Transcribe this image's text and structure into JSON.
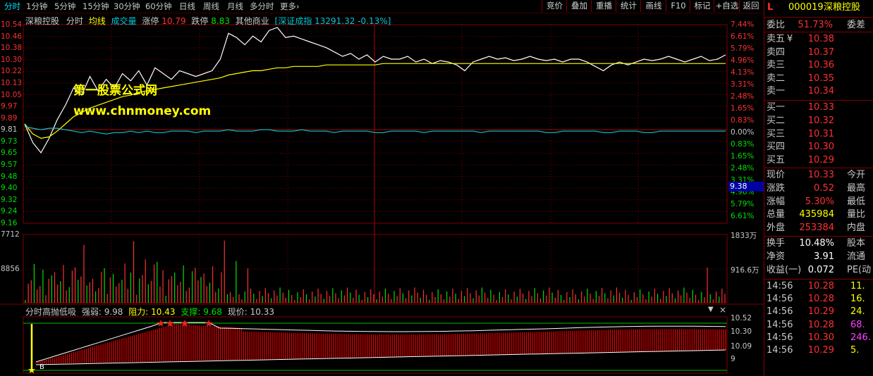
{
  "toolbar": {
    "timeframes": [
      "分时",
      "1分钟",
      "5分钟",
      "15分钟",
      "30分钟",
      "60分钟",
      "日线",
      "周线",
      "月线",
      "多分时",
      "更多›"
    ],
    "tools": [
      "竞价",
      "叠加",
      "重播",
      "统计",
      "画线",
      "F10",
      "标记",
      "+自选",
      "返回"
    ]
  },
  "chart_header": {
    "stock_name": "深粮控股",
    "mode": "分时",
    "avg_label": "均线",
    "volume_label": "成交量",
    "limit_up_label": "涨停",
    "limit_up_value": "10.79",
    "limit_down_label": "跌停",
    "limit_down_value": "8.83",
    "sector": "其他商业",
    "index_text": "[深证成指 13291.32 -0.13%]"
  },
  "price_axis": {
    "left": [
      "10.54",
      "10.46",
      "10.38",
      "10.30",
      "10.22",
      "10.13",
      "10.05",
      "9.97",
      "9.89",
      "9.81",
      "9.73",
      "9.65",
      "9.57",
      "9.48",
      "9.40",
      "9.32",
      "9.24",
      "9.16"
    ],
    "right": [
      "7.44%",
      "6.61%",
      "5.79%",
      "4.96%",
      "4.13%",
      "3.31%",
      "2.48%",
      "1.65%",
      "0.83%",
      "0.00%",
      "0.83%",
      "1.65%",
      "2.48%",
      "3.31%",
      "4.96%",
      "5.79%",
      "6.61%"
    ],
    "cursor_value": "9.38"
  },
  "volume_axis": {
    "left_top": "7712",
    "left_mid": "8856",
    "right_top": "1833万",
    "right_mid": "916.6万"
  },
  "watermark": {
    "line1": "第一股票公式网",
    "line2": "www.chnmoney.com"
  },
  "indicator": {
    "name": "分时高抛低吸",
    "strength_label": "强弱:",
    "strength_value": "9.98",
    "resistance_label": "阻力:",
    "resistance_value": "10.43",
    "support_label": "支撑:",
    "support_value": "9.68",
    "price_label": "现价:",
    "price_value": "10.33",
    "axis": [
      "10.52",
      "10.30",
      "10.09",
      "9"
    ],
    "buy_marker": "B"
  },
  "quote": {
    "code_prefix": "L",
    "code": "000019",
    "name": "深粮控股",
    "weibi_label": "委比",
    "weibi_value": "51.73%",
    "weicha_label": "委差",
    "asks": [
      {
        "label": "卖五",
        "mark": "¥",
        "price": "10.38"
      },
      {
        "label": "卖四",
        "mark": "",
        "price": "10.37"
      },
      {
        "label": "卖三",
        "mark": "",
        "price": "10.36"
      },
      {
        "label": "卖二",
        "mark": "",
        "price": "10.35"
      },
      {
        "label": "卖一",
        "mark": "",
        "price": "10.34"
      }
    ],
    "bids": [
      {
        "label": "买一",
        "price": "10.33"
      },
      {
        "label": "买二",
        "price": "10.32"
      },
      {
        "label": "买三",
        "price": "10.31"
      },
      {
        "label": "买四",
        "price": "10.30"
      },
      {
        "label": "买五",
        "price": "10.29"
      }
    ],
    "stats": [
      {
        "label": "现价",
        "value": "10.33",
        "right": "今开",
        "color": "red"
      },
      {
        "label": "涨跌",
        "value": "0.52",
        "right": "最高",
        "color": "red"
      },
      {
        "label": "涨幅",
        "value": "5.30%",
        "right": "最低",
        "color": "red"
      },
      {
        "label": "总量",
        "value": "435984",
        "right": "量比",
        "color": "yellow"
      },
      {
        "label": "外盘",
        "value": "253384",
        "right": "内盘",
        "color": "red"
      }
    ],
    "stats2": [
      {
        "label": "换手",
        "value": "10.48%",
        "right": "股本",
        "color": "white"
      },
      {
        "label": "净资",
        "value": "3.91",
        "right": "流通",
        "color": "white"
      },
      {
        "label": "收益(一)",
        "value": "0.072",
        "right": "PE(动",
        "color": "white"
      }
    ],
    "ticks": [
      {
        "time": "14:56",
        "price": "10.28",
        "vol": "11.",
        "vc": "yellow"
      },
      {
        "time": "14:56",
        "price": "10.28",
        "vol": "16.",
        "vc": "yellow"
      },
      {
        "time": "14:56",
        "price": "10.29",
        "vol": "24.",
        "vc": "yellow"
      },
      {
        "time": "14:56",
        "price": "10.28",
        "vol": "68.",
        "vc": "magenta"
      },
      {
        "time": "14:56",
        "price": "10.30",
        "vol": "246.",
        "vc": "magenta"
      },
      {
        "time": "14:56",
        "price": "10.29",
        "vol": "5.",
        "vc": "yellow"
      }
    ]
  },
  "colors": {
    "up": "#ff3030",
    "down": "#00e000",
    "price_line": "#ffffff",
    "avg_line": "#ffff00",
    "index_line": "#00c8d8",
    "grid": "#800000"
  },
  "chart_data": {
    "type": "line",
    "title": "",
    "prev_close": 9.81,
    "ylim": [
      9.16,
      10.54
    ],
    "series": [
      {
        "name": "分时",
        "values": [
          9.85,
          9.72,
          9.65,
          9.75,
          9.88,
          9.98,
          10.1,
          10.05,
          10.18,
          10.08,
          10.16,
          10.1,
          10.2,
          10.15,
          10.22,
          10.12,
          10.24,
          10.2,
          10.16,
          10.22,
          10.2,
          10.18,
          10.2,
          10.22,
          10.3,
          10.48,
          10.45,
          10.4,
          10.46,
          10.42,
          10.5,
          10.52,
          10.45,
          10.46,
          10.44,
          10.42,
          10.4,
          10.38,
          10.35,
          10.32,
          10.34,
          10.3,
          10.33,
          10.28,
          10.32,
          10.3,
          10.3,
          10.32,
          10.28,
          10.3,
          10.27,
          10.29,
          10.28,
          10.26,
          10.22,
          10.28,
          10.3,
          10.32,
          10.3,
          10.31,
          10.29,
          10.3,
          10.32,
          10.3,
          10.29,
          10.3,
          10.28,
          10.3,
          10.3,
          10.28,
          10.25,
          10.22,
          10.26,
          10.28,
          10.26,
          10.28,
          10.3,
          10.29,
          10.3,
          10.32,
          10.3,
          10.28,
          10.3,
          10.32,
          10.29,
          10.3,
          10.33
        ]
      },
      {
        "name": "均线",
        "values": [
          9.85,
          9.78,
          9.75,
          9.76,
          9.8,
          9.85,
          9.9,
          9.93,
          9.96,
          9.98,
          10.0,
          10.02,
          10.04,
          10.05,
          10.07,
          10.08,
          10.09,
          10.1,
          10.11,
          10.12,
          10.13,
          10.14,
          10.15,
          10.16,
          10.17,
          10.19,
          10.2,
          10.21,
          10.22,
          10.22,
          10.23,
          10.24,
          10.24,
          10.25,
          10.25,
          10.25,
          10.25,
          10.26,
          10.26,
          10.26,
          10.26,
          10.26,
          10.26,
          10.26,
          10.27,
          10.27,
          10.27,
          10.27,
          10.27,
          10.27,
          10.27,
          10.27,
          10.27,
          10.27,
          10.27,
          10.27,
          10.27,
          10.27,
          10.27,
          10.27,
          10.27,
          10.27,
          10.27,
          10.27,
          10.27,
          10.27,
          10.27,
          10.27,
          10.27,
          10.27,
          10.27,
          10.27,
          10.27,
          10.27,
          10.27,
          10.27,
          10.27,
          10.27,
          10.27,
          10.27,
          10.27,
          10.27,
          10.27,
          10.27,
          10.27,
          10.27,
          10.27
        ]
      },
      {
        "name": "深证成指",
        "values": [
          9.83,
          9.82,
          9.81,
          9.82,
          9.82,
          9.81,
          9.8,
          9.79,
          9.8,
          9.79,
          9.78,
          9.79,
          9.79,
          9.8,
          9.79,
          9.8,
          9.79,
          9.79,
          9.8,
          9.8,
          9.8,
          9.79,
          9.8,
          9.8,
          9.8,
          9.81,
          9.8,
          9.8,
          9.8,
          9.81,
          9.81,
          9.8,
          9.8,
          9.8,
          9.81,
          9.8,
          9.8,
          9.8,
          9.79,
          9.8,
          9.8,
          9.8,
          9.8,
          9.79,
          9.79,
          9.8,
          9.8,
          9.8,
          9.8,
          9.79,
          9.8,
          9.8,
          9.8,
          9.8,
          9.8,
          9.8,
          9.79,
          9.8,
          9.8,
          9.8,
          9.8,
          9.8,
          9.8,
          9.8,
          9.79,
          9.79,
          9.8,
          9.8,
          9.8,
          9.8,
          9.8,
          9.79,
          9.79,
          9.8,
          9.8,
          9.8,
          9.79,
          9.79,
          9.8,
          9.8,
          9.8,
          9.8,
          9.8,
          9.8,
          9.8,
          9.8,
          9.8
        ]
      }
    ]
  }
}
